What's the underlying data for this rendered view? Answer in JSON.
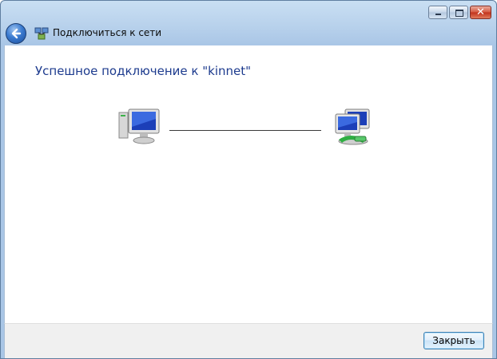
{
  "window": {
    "title": "Подключиться к сети",
    "buttons": {
      "minimize": "minimize-icon",
      "maximize": "maximize-icon",
      "close": "close-icon",
      "close_glyph": "✕"
    }
  },
  "content": {
    "heading": "Успешное подключение к \"kinnet\""
  },
  "footer": {
    "close_label": "Закрыть"
  },
  "colors": {
    "heading": "#1d3b8e",
    "titlebar": "#b9d2ec",
    "close_button": "#c0301a"
  }
}
